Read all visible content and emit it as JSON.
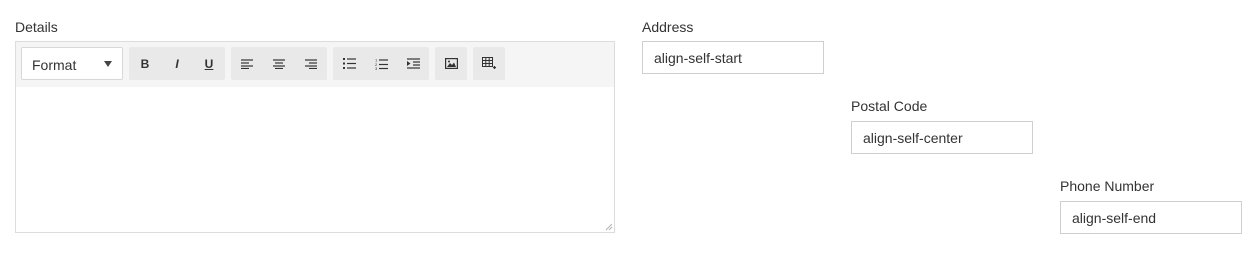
{
  "details": {
    "label": "Details",
    "toolbar": {
      "format_label": "Format",
      "bold_label": "B",
      "italic_label": "I",
      "underline_label": "U"
    },
    "content": ""
  },
  "address": {
    "label": "Address",
    "value": "align-self-start"
  },
  "postal_code": {
    "label": "Postal Code",
    "value": "align-self-center"
  },
  "phone_number": {
    "label": "Phone Number",
    "value": "align-self-end"
  },
  "icons": [
    "caret-down-icon",
    "align-left-icon",
    "align-center-icon",
    "align-right-icon",
    "bulleted-list-icon",
    "numbered-list-icon",
    "indent-icon",
    "image-icon",
    "table-icon",
    "resize-handle-icon"
  ]
}
